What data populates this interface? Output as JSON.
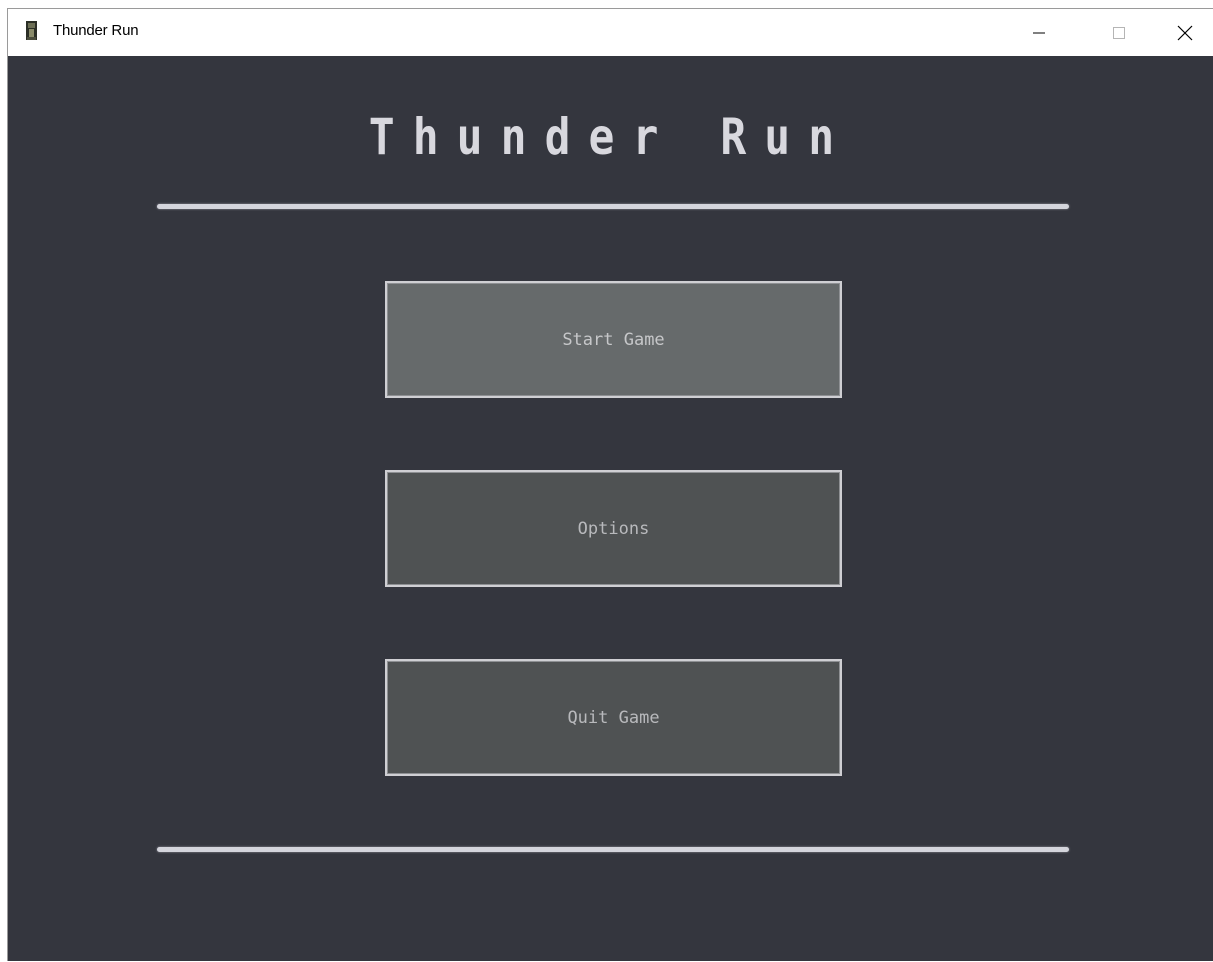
{
  "window": {
    "title": "Thunder Run",
    "icon": "app-icon",
    "controls": {
      "minimize_icon": "minimize-icon",
      "maximize_icon": "maximize-icon",
      "close_icon": "close-icon"
    }
  },
  "game": {
    "title": "Thunder Run",
    "menu": {
      "start_label": "Start Game",
      "options_label": "Options",
      "quit_label": "Quit Game",
      "highlighted": "Start Game"
    }
  },
  "colors": {
    "background": "#34363e",
    "title_text": "#d8d8de",
    "divider": "#d4d5dc",
    "button_bg": "#4f5253",
    "button_bg_highlighted": "#666a6b",
    "button_border": "#cfcfd3",
    "button_text": "#b8b9bc"
  }
}
